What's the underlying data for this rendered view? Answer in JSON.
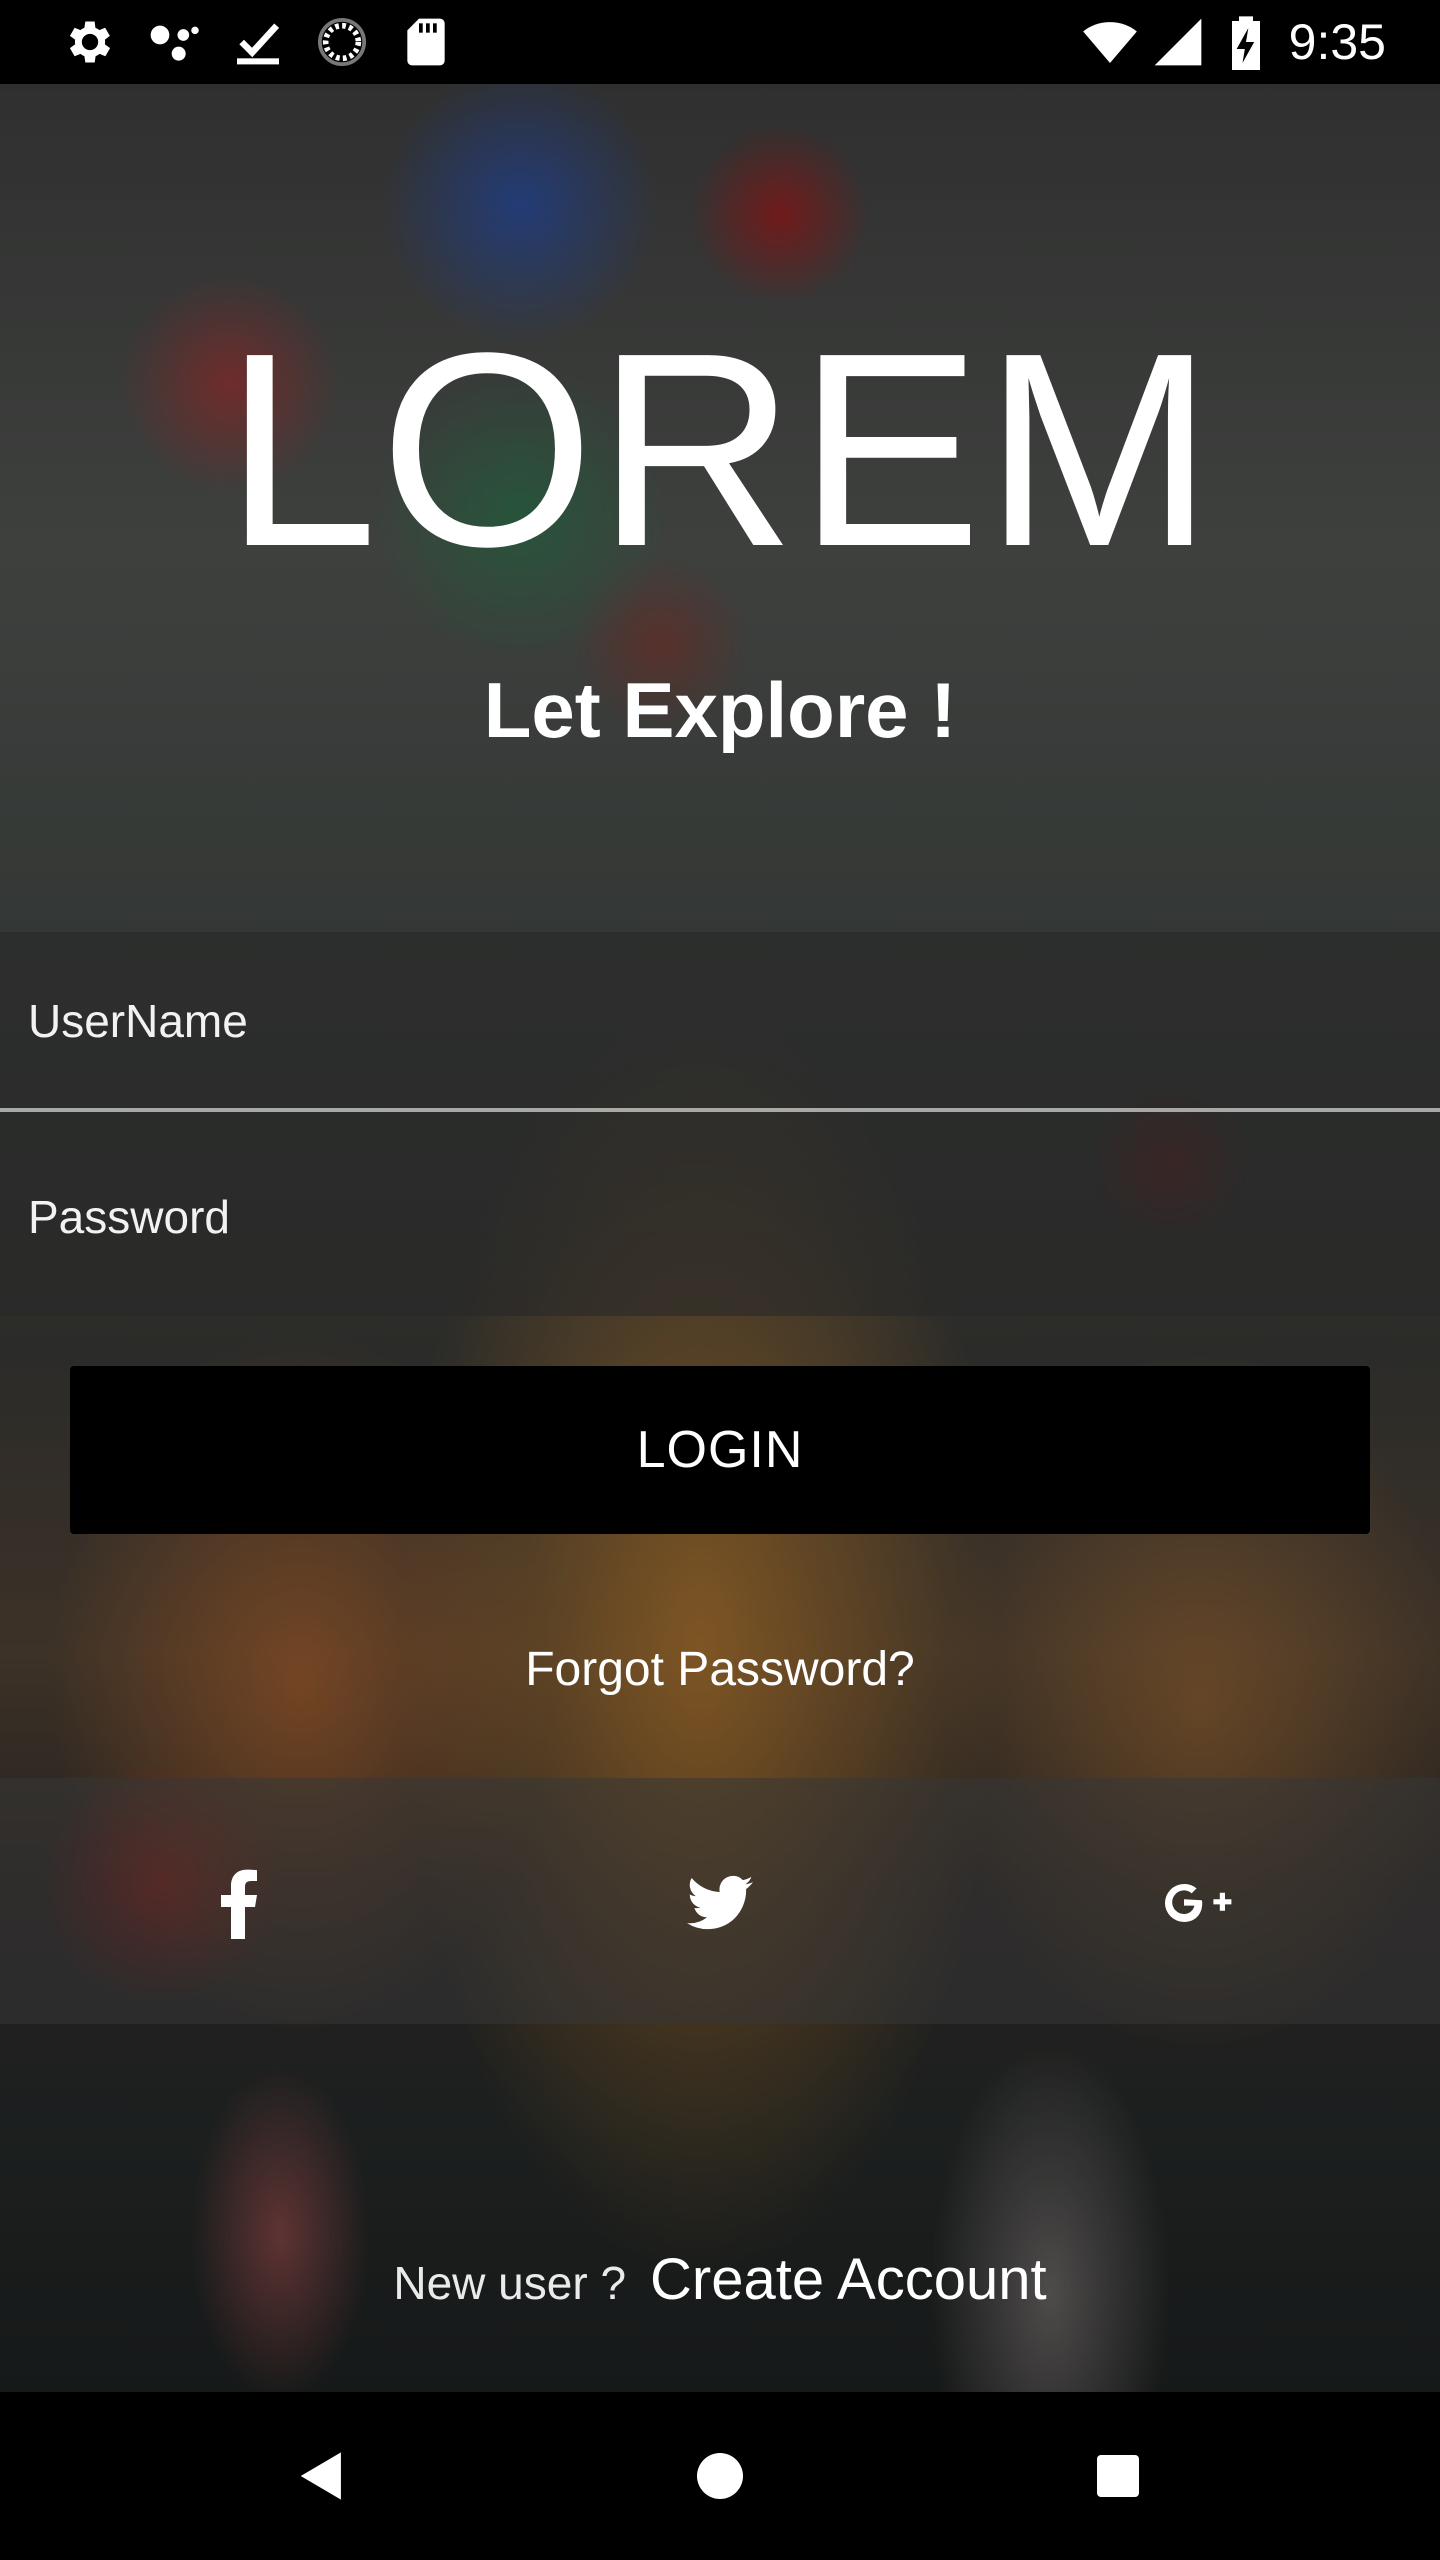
{
  "status_bar": {
    "time": "9:35",
    "icons": [
      "settings-icon",
      "assistant-dots-icon",
      "download-done-icon",
      "sync-progress-icon",
      "sd-card-icon",
      "wifi-icon",
      "cellular-signal-icon",
      "battery-charging-icon"
    ]
  },
  "brand": {
    "title": "LOREM",
    "tagline": "Let Explore !"
  },
  "form": {
    "username_placeholder": "UserName",
    "password_placeholder": "Password",
    "login_label": "LOGIN",
    "forgot_password": "Forgot Password?"
  },
  "social": {
    "icons": [
      "facebook-icon",
      "twitter-icon",
      "google-plus-icon"
    ]
  },
  "footer": {
    "new_user": "New user ?",
    "create_account": "Create Account"
  },
  "nav_bar": {
    "icons": [
      "back-icon",
      "home-icon",
      "recents-icon"
    ]
  },
  "colors": {
    "text": "#ffffff",
    "button_background": "#000000",
    "form_overlay": "#282828",
    "status_bar": "#000000"
  }
}
